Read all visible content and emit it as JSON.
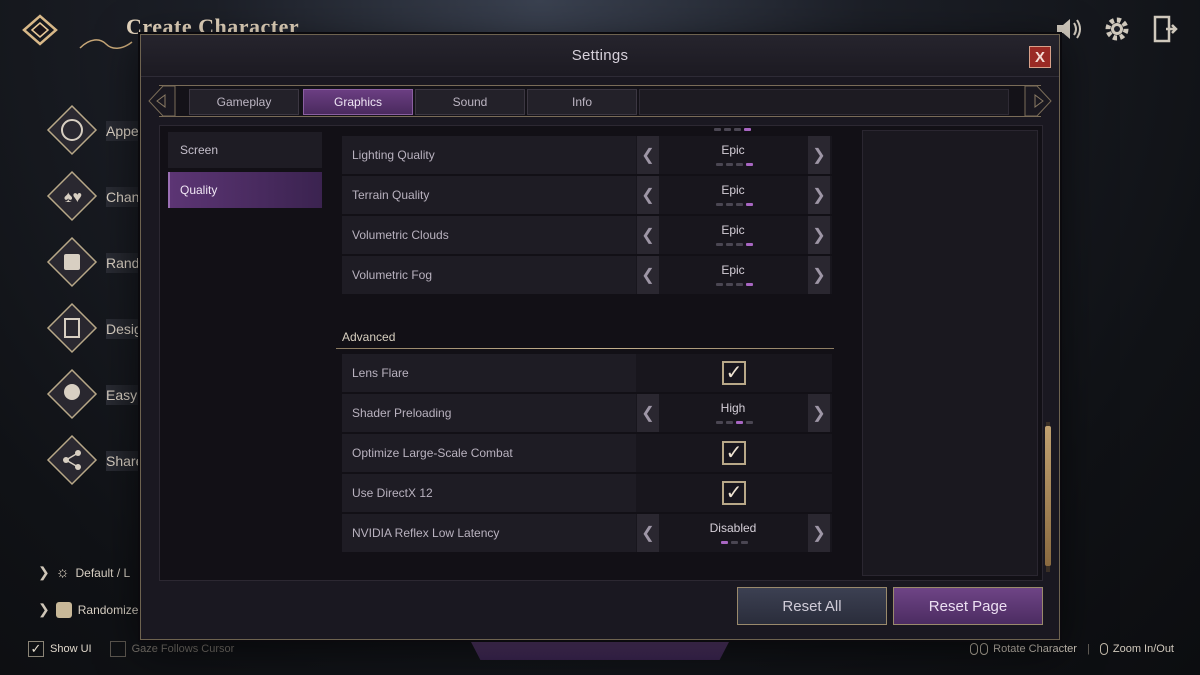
{
  "background": {
    "title": "Create Character",
    "side_items": [
      {
        "label": "Appe",
        "icon": "palette-icon"
      },
      {
        "label": "Chan",
        "icon": "cards-icon"
      },
      {
        "label": "Rand",
        "icon": "dice-icon"
      },
      {
        "label": "Desig",
        "icon": "portrait-icon"
      },
      {
        "label": "Easy",
        "icon": "face-icon"
      },
      {
        "label": "Share",
        "icon": "share-icon"
      }
    ],
    "bottom_rows": [
      {
        "label": "Default / L",
        "icon": "sun-icon"
      },
      {
        "label": "Randomize",
        "icon": "dice-icon"
      }
    ],
    "show_ui_label": "Show UI",
    "gaze_label": "Gaze Follows Cursor",
    "rotate_label": "Rotate Character",
    "zoom_label": "Zoom In/Out"
  },
  "settings": {
    "title": "Settings",
    "close_label": "X",
    "tabs": [
      {
        "label": "Gameplay",
        "active": false
      },
      {
        "label": "Graphics",
        "active": true
      },
      {
        "label": "Sound",
        "active": false
      },
      {
        "label": "Info",
        "active": false
      }
    ],
    "subnav": [
      {
        "label": "Screen",
        "active": false
      },
      {
        "label": "Quality",
        "active": true
      }
    ],
    "quality_rows": [
      {
        "label": "Lighting Quality",
        "value": "Epic",
        "dots": [
          0,
          0,
          0,
          1
        ]
      },
      {
        "label": "Terrain Quality",
        "value": "Epic",
        "dots": [
          0,
          0,
          0,
          1
        ]
      },
      {
        "label": "Volumetric Clouds",
        "value": "Epic",
        "dots": [
          0,
          0,
          0,
          1
        ]
      },
      {
        "label": "Volumetric Fog",
        "value": "Epic",
        "dots": [
          0,
          0,
          0,
          1
        ]
      }
    ],
    "advanced_title": "Advanced",
    "advanced_rows": [
      {
        "label": "Lens Flare",
        "type": "checkbox",
        "checked": true
      },
      {
        "label": "Shader Preloading",
        "type": "select",
        "value": "High",
        "dots": [
          0,
          0,
          1,
          0
        ]
      },
      {
        "label": "Optimize Large-Scale Combat",
        "type": "checkbox",
        "checked": true
      },
      {
        "label": "Use DirectX 12",
        "type": "checkbox",
        "checked": true
      },
      {
        "label": "NVIDIA Reflex Low Latency",
        "type": "select",
        "value": "Disabled",
        "dots": [
          1,
          0,
          0
        ]
      }
    ],
    "reset_all_label": "Reset All",
    "reset_page_label": "Reset Page"
  }
}
